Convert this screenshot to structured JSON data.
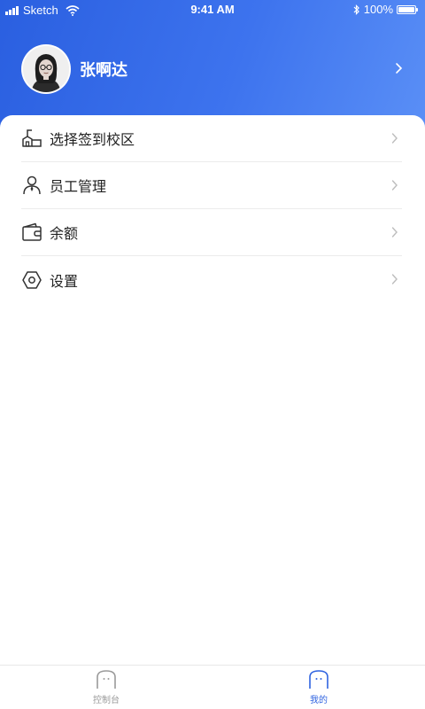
{
  "status_bar": {
    "carrier": "Sketch",
    "time": "9:41 AM",
    "battery": "100%",
    "icons": [
      "signal-icon",
      "wifi-icon",
      "bluetooth-icon",
      "battery-icon"
    ]
  },
  "profile": {
    "name": "张啊达",
    "avatar_icon": "avatar"
  },
  "menu": {
    "items": [
      {
        "label": "选择签到校区",
        "icon": "school-icon"
      },
      {
        "label": "员工管理",
        "icon": "employee-icon"
      },
      {
        "label": "余额",
        "icon": "wallet-icon"
      },
      {
        "label": "设置",
        "icon": "settings-icon"
      }
    ]
  },
  "tabbar": {
    "tabs": [
      {
        "label": "控制台",
        "icon": "console-icon",
        "active": false
      },
      {
        "label": "我的",
        "icon": "mine-icon",
        "active": true
      }
    ]
  },
  "colors": {
    "primary": "#2f63e0",
    "header_gradient_start": "#2a5fe0",
    "header_gradient_end": "#5a8ff6",
    "tab_inactive": "#9a9a9a"
  }
}
